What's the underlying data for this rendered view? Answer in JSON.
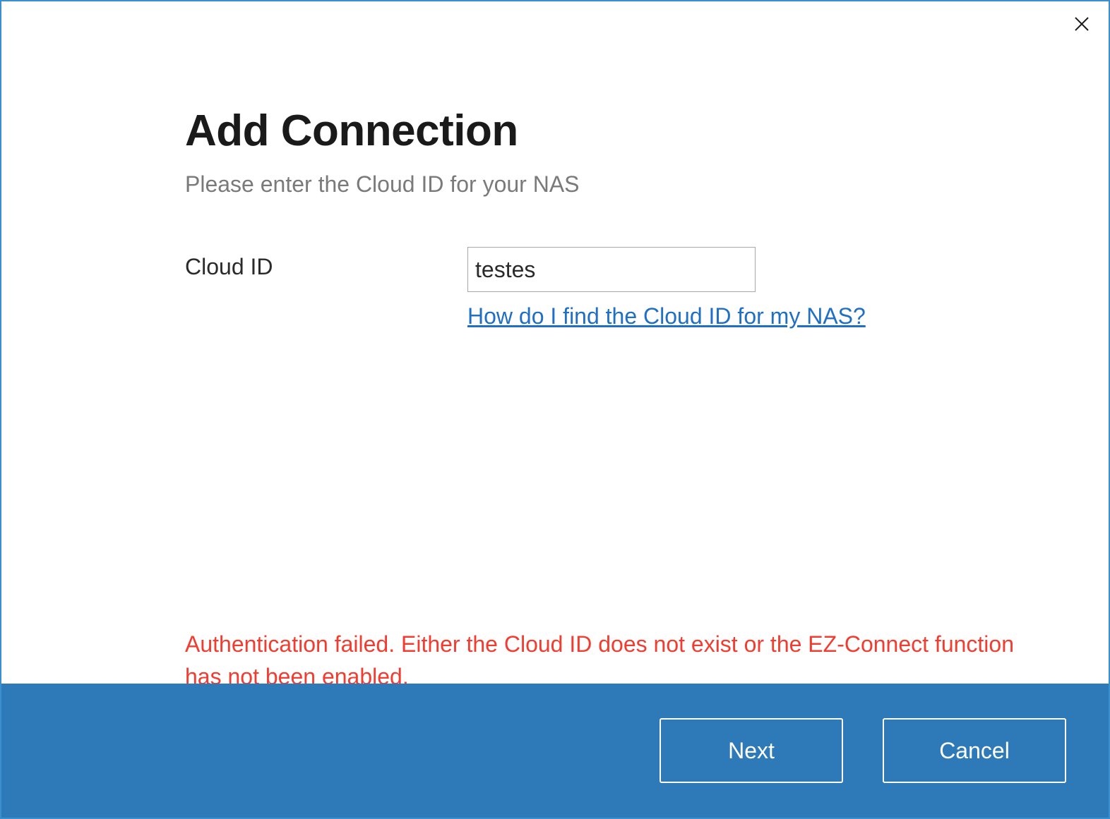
{
  "dialog": {
    "title": "Add Connection",
    "subtitle": "Please enter the Cloud ID for your NAS"
  },
  "form": {
    "cloud_id_label": "Cloud ID",
    "cloud_id_value": "testes",
    "help_link_text": "How do I find the Cloud ID for my NAS?"
  },
  "error": {
    "message": "Authentication failed. Either the Cloud ID does not exist or the EZ-Connect function has not been enabled."
  },
  "footer": {
    "next_label": "Next",
    "cancel_label": "Cancel"
  }
}
